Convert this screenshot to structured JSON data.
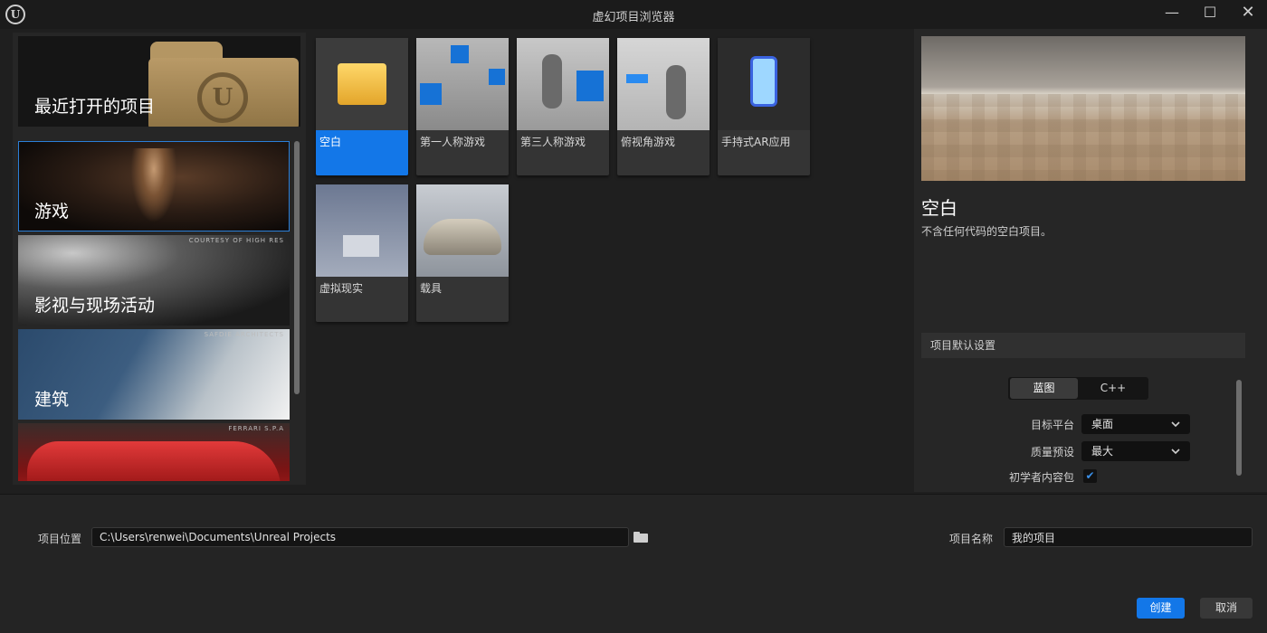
{
  "window": {
    "title": "虚幻项目浏览器",
    "logo_glyph": "U",
    "minimize_glyph": "—",
    "maximize_glyph": "☐",
    "close_glyph": "✕"
  },
  "recent": {
    "label": "最近打开的项目",
    "logo_glyph": "U"
  },
  "categories": [
    {
      "label": "游戏",
      "selected": true
    },
    {
      "label": "影视与现场活动",
      "credit": "COURTESY OF HIGH RES"
    },
    {
      "label": "建筑",
      "credit": "SAFDIE ARCHITECTS"
    },
    {
      "label": "",
      "credit": "FERRARI S.P.A"
    }
  ],
  "templates": [
    {
      "label": "空白",
      "selected": true
    },
    {
      "label": "第一人称游戏"
    },
    {
      "label": "第三人称游戏"
    },
    {
      "label": "俯视角游戏"
    },
    {
      "label": "手持式AR应用"
    },
    {
      "label": "虚拟现实"
    },
    {
      "label": "载具"
    }
  ],
  "details": {
    "title": "空白",
    "description": "不含任何代码的空白项目。",
    "defaults_header": "项目默认设置",
    "toggle": {
      "blueprint": "蓝图",
      "cpp": "C++",
      "selected": "蓝图"
    },
    "target_platform": {
      "label": "目标平台",
      "value": "桌面"
    },
    "quality_preset": {
      "label": "质量预设",
      "value": "最大"
    },
    "starter_content": {
      "label": "初学者内容包",
      "checked": true
    }
  },
  "bottom": {
    "location_label": "项目位置",
    "location_value": "C:\\Users\\renwei\\Documents\\Unreal Projects",
    "name_label": "项目名称",
    "name_value": "我的项目",
    "create_label": "创建",
    "cancel_label": "取消"
  },
  "icons": {
    "chevron": "chevron-down-icon",
    "check": "✔"
  },
  "colors": {
    "accent": "#1377e8",
    "background": "#1f1f1f",
    "panel": "#262626"
  }
}
